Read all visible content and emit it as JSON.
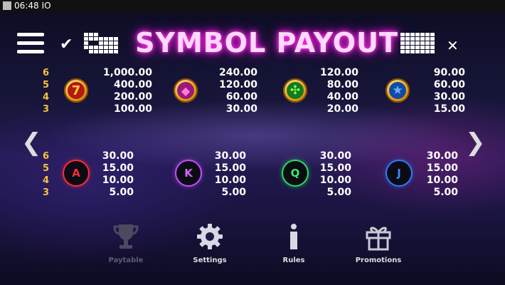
{
  "status_bar": {
    "time": "06:48",
    "extra": "IO"
  },
  "header": {
    "title": "SYMBOL PAYOUT",
    "check_icon": "✔",
    "close_icon": "✕"
  },
  "paytable": {
    "row1": {
      "counts": [
        "6",
        "5",
        "4",
        "3"
      ],
      "symbols": [
        {
          "name": "seven",
          "glyph": "7",
          "payouts": [
            "1,000.00",
            "400.00",
            "200.00",
            "100.00"
          ]
        },
        {
          "name": "diamond",
          "glyph": "◆",
          "payouts": [
            "240.00",
            "120.00",
            "60.00",
            "30.00"
          ]
        },
        {
          "name": "clover",
          "glyph": "✣",
          "payouts": [
            "120.00",
            "80.00",
            "40.00",
            "20.00"
          ]
        },
        {
          "name": "star",
          "glyph": "★",
          "payouts": [
            "90.00",
            "60.00",
            "30.00",
            "15.00"
          ]
        }
      ]
    },
    "row2": {
      "counts": [
        "6",
        "5",
        "4",
        "3"
      ],
      "symbols": [
        {
          "name": "a",
          "glyph": "A",
          "color": "#ff2a3a",
          "payouts": [
            "30.00",
            "15.00",
            "10.00",
            "5.00"
          ]
        },
        {
          "name": "k",
          "glyph": "K",
          "color": "#c44dff",
          "payouts": [
            "30.00",
            "15.00",
            "10.00",
            "5.00"
          ]
        },
        {
          "name": "q",
          "glyph": "Q",
          "color": "#22e05a",
          "payouts": [
            "30.00",
            "15.00",
            "10.00",
            "5.00"
          ]
        },
        {
          "name": "j",
          "glyph": "J",
          "color": "#2b7bff",
          "payouts": [
            "30.00",
            "15.00",
            "10.00",
            "5.00"
          ]
        }
      ]
    }
  },
  "nav": {
    "paytable": "Paytable",
    "settings": "Settings",
    "rules": "Rules",
    "promotions": "Promotions"
  },
  "arrows": {
    "left": "❮",
    "right": "❯"
  }
}
